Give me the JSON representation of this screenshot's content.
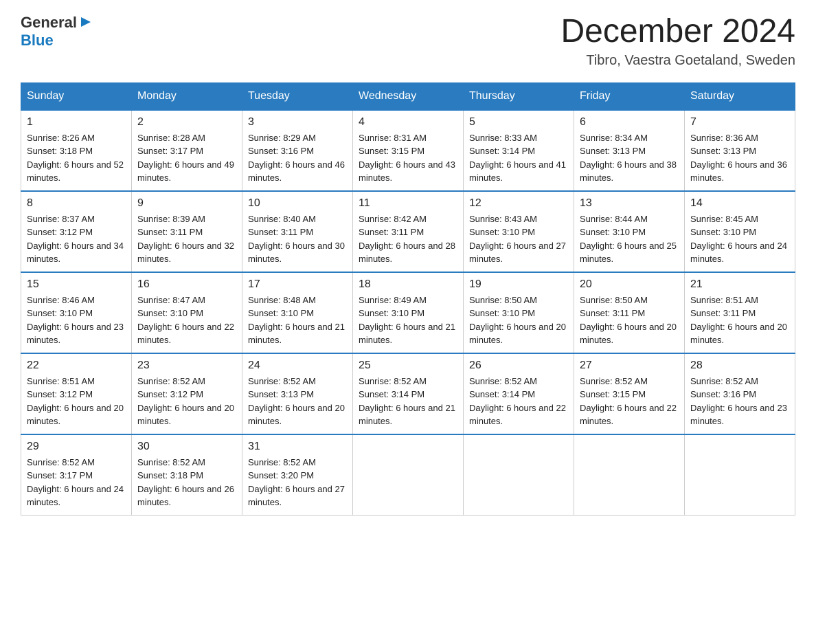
{
  "header": {
    "logo_general": "General",
    "logo_blue": "Blue",
    "title": "December 2024",
    "location": "Tibro, Vaestra Goetaland, Sweden"
  },
  "days_of_week": [
    "Sunday",
    "Monday",
    "Tuesday",
    "Wednesday",
    "Thursday",
    "Friday",
    "Saturday"
  ],
  "weeks": [
    [
      {
        "day": "1",
        "sunrise": "8:26 AM",
        "sunset": "3:18 PM",
        "daylight": "6 hours and 52 minutes."
      },
      {
        "day": "2",
        "sunrise": "8:28 AM",
        "sunset": "3:17 PM",
        "daylight": "6 hours and 49 minutes."
      },
      {
        "day": "3",
        "sunrise": "8:29 AM",
        "sunset": "3:16 PM",
        "daylight": "6 hours and 46 minutes."
      },
      {
        "day": "4",
        "sunrise": "8:31 AM",
        "sunset": "3:15 PM",
        "daylight": "6 hours and 43 minutes."
      },
      {
        "day": "5",
        "sunrise": "8:33 AM",
        "sunset": "3:14 PM",
        "daylight": "6 hours and 41 minutes."
      },
      {
        "day": "6",
        "sunrise": "8:34 AM",
        "sunset": "3:13 PM",
        "daylight": "6 hours and 38 minutes."
      },
      {
        "day": "7",
        "sunrise": "8:36 AM",
        "sunset": "3:13 PM",
        "daylight": "6 hours and 36 minutes."
      }
    ],
    [
      {
        "day": "8",
        "sunrise": "8:37 AM",
        "sunset": "3:12 PM",
        "daylight": "6 hours and 34 minutes."
      },
      {
        "day": "9",
        "sunrise": "8:39 AM",
        "sunset": "3:11 PM",
        "daylight": "6 hours and 32 minutes."
      },
      {
        "day": "10",
        "sunrise": "8:40 AM",
        "sunset": "3:11 PM",
        "daylight": "6 hours and 30 minutes."
      },
      {
        "day": "11",
        "sunrise": "8:42 AM",
        "sunset": "3:11 PM",
        "daylight": "6 hours and 28 minutes."
      },
      {
        "day": "12",
        "sunrise": "8:43 AM",
        "sunset": "3:10 PM",
        "daylight": "6 hours and 27 minutes."
      },
      {
        "day": "13",
        "sunrise": "8:44 AM",
        "sunset": "3:10 PM",
        "daylight": "6 hours and 25 minutes."
      },
      {
        "day": "14",
        "sunrise": "8:45 AM",
        "sunset": "3:10 PM",
        "daylight": "6 hours and 24 minutes."
      }
    ],
    [
      {
        "day": "15",
        "sunrise": "8:46 AM",
        "sunset": "3:10 PM",
        "daylight": "6 hours and 23 minutes."
      },
      {
        "day": "16",
        "sunrise": "8:47 AM",
        "sunset": "3:10 PM",
        "daylight": "6 hours and 22 minutes."
      },
      {
        "day": "17",
        "sunrise": "8:48 AM",
        "sunset": "3:10 PM",
        "daylight": "6 hours and 21 minutes."
      },
      {
        "day": "18",
        "sunrise": "8:49 AM",
        "sunset": "3:10 PM",
        "daylight": "6 hours and 21 minutes."
      },
      {
        "day": "19",
        "sunrise": "8:50 AM",
        "sunset": "3:10 PM",
        "daylight": "6 hours and 20 minutes."
      },
      {
        "day": "20",
        "sunrise": "8:50 AM",
        "sunset": "3:11 PM",
        "daylight": "6 hours and 20 minutes."
      },
      {
        "day": "21",
        "sunrise": "8:51 AM",
        "sunset": "3:11 PM",
        "daylight": "6 hours and 20 minutes."
      }
    ],
    [
      {
        "day": "22",
        "sunrise": "8:51 AM",
        "sunset": "3:12 PM",
        "daylight": "6 hours and 20 minutes."
      },
      {
        "day": "23",
        "sunrise": "8:52 AM",
        "sunset": "3:12 PM",
        "daylight": "6 hours and 20 minutes."
      },
      {
        "day": "24",
        "sunrise": "8:52 AM",
        "sunset": "3:13 PM",
        "daylight": "6 hours and 20 minutes."
      },
      {
        "day": "25",
        "sunrise": "8:52 AM",
        "sunset": "3:14 PM",
        "daylight": "6 hours and 21 minutes."
      },
      {
        "day": "26",
        "sunrise": "8:52 AM",
        "sunset": "3:14 PM",
        "daylight": "6 hours and 22 minutes."
      },
      {
        "day": "27",
        "sunrise": "8:52 AM",
        "sunset": "3:15 PM",
        "daylight": "6 hours and 22 minutes."
      },
      {
        "day": "28",
        "sunrise": "8:52 AM",
        "sunset": "3:16 PM",
        "daylight": "6 hours and 23 minutes."
      }
    ],
    [
      {
        "day": "29",
        "sunrise": "8:52 AM",
        "sunset": "3:17 PM",
        "daylight": "6 hours and 24 minutes."
      },
      {
        "day": "30",
        "sunrise": "8:52 AM",
        "sunset": "3:18 PM",
        "daylight": "6 hours and 26 minutes."
      },
      {
        "day": "31",
        "sunrise": "8:52 AM",
        "sunset": "3:20 PM",
        "daylight": "6 hours and 27 minutes."
      },
      null,
      null,
      null,
      null
    ]
  ]
}
